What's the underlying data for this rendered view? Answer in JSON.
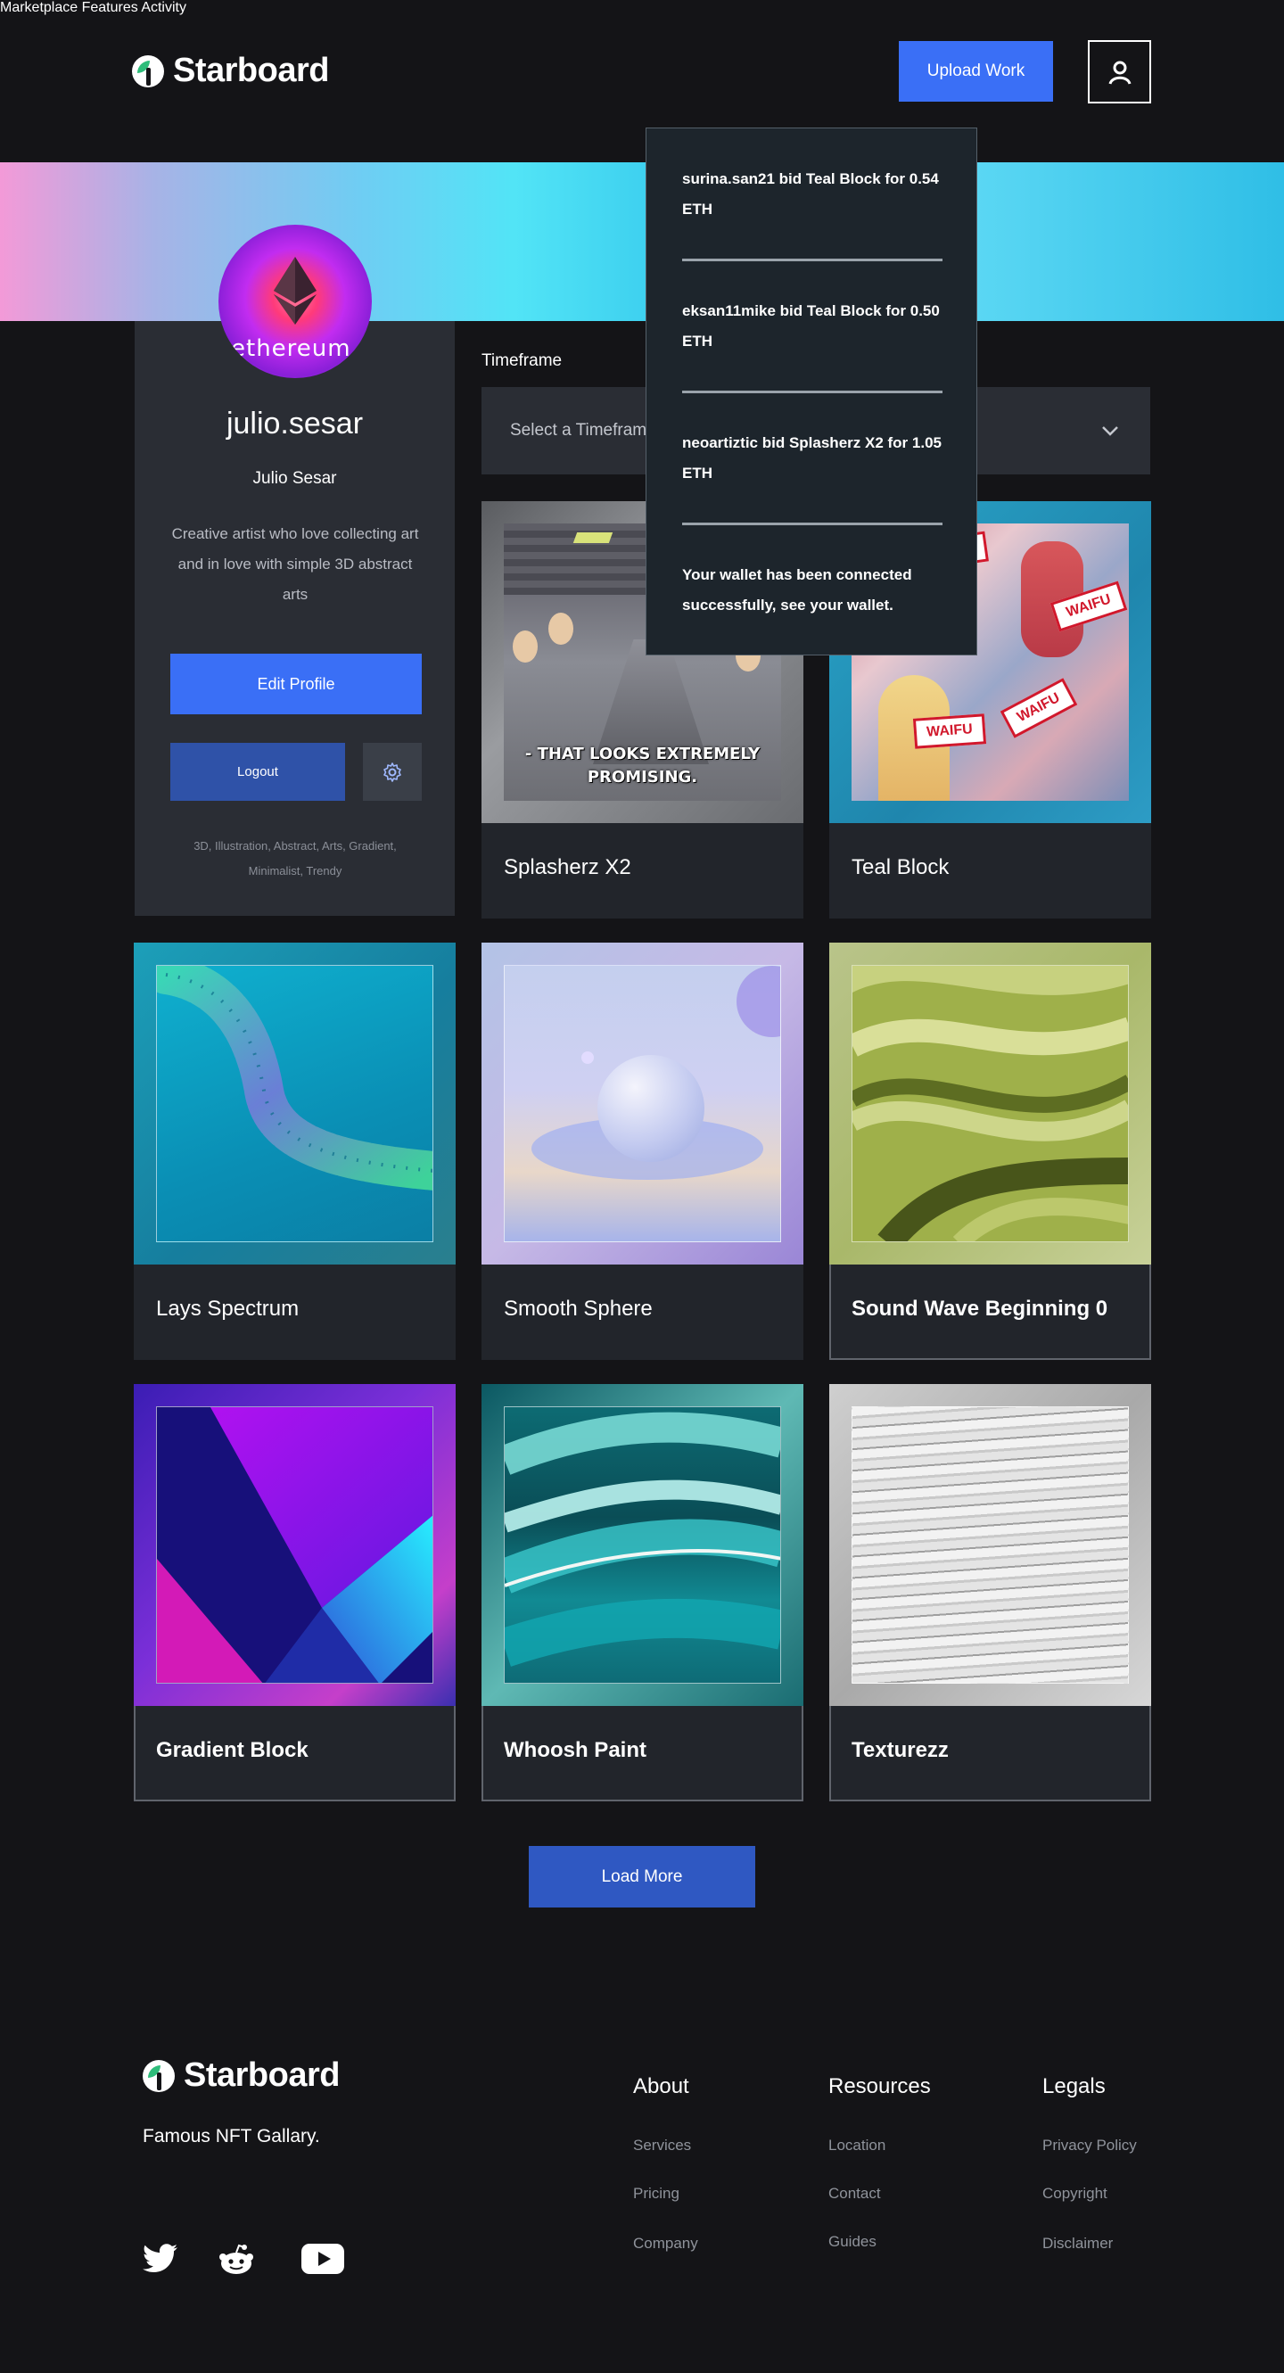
{
  "header": {
    "brand": "Starboard",
    "nav": [
      {
        "label": "Marketplace"
      },
      {
        "label": "Features"
      },
      {
        "label": "Activity"
      }
    ],
    "upload_label": "Upload Work",
    "user_icon": "user-icon"
  },
  "activity": {
    "items": [
      "surina.san21 bid Teal Block for 0.54 ETH",
      "eksan11mike bid Teal Block for 0.50 ETH",
      "neoartiztic bid Splasherz X2 for 1.05 ETH",
      "Your wallet has been connected successfully, see your wallet."
    ]
  },
  "profile": {
    "avatar_text": "ethereum",
    "handle": "julio.sesar",
    "name": "Julio Sesar",
    "bio": "Creative artist who love collecting art and in love with simple 3D abstract arts",
    "edit_label": "Edit Profile",
    "logout_label": "Logout",
    "settings_icon": "gear-icon",
    "tags": "3D, Illustration, Abstract, Arts, Gradient, Minimalist, Trendy"
  },
  "filter": {
    "label": "Timeframe",
    "placeholder": "Select a Timeframe"
  },
  "cards": [
    {
      "title": "Splasherz X2",
      "meme_caption": "- THAT LOOKS EXTREMELY PROMISING."
    },
    {
      "title": "Teal Block",
      "sign_text": "WAIFU"
    },
    {
      "title": "Lays Spectrum"
    },
    {
      "title": "Smooth Sphere"
    },
    {
      "title": "Sound Wave Beginning 0"
    },
    {
      "title": "Gradient Block"
    },
    {
      "title": "Whoosh Paint"
    },
    {
      "title": "Texturezz"
    }
  ],
  "load_more_label": "Load More",
  "footer": {
    "brand": "Starboard",
    "tagline": "Famous NFT Gallary.",
    "columns": [
      {
        "heading": "About",
        "links": [
          "Services",
          "Pricing",
          "Company"
        ]
      },
      {
        "heading": "Resources",
        "links": [
          "Location",
          "Contact",
          "Guides"
        ]
      },
      {
        "heading": "Legals",
        "links": [
          "Privacy Policy",
          "Copyright",
          "Disclaimer"
        ]
      }
    ],
    "social": [
      "twitter-icon",
      "reddit-icon",
      "youtube-icon"
    ]
  },
  "colors": {
    "background": "#141417",
    "card": "#22252b",
    "primary_blue": "#3a6ff6",
    "dark_blue": "#2f52a8",
    "dropdown_bg": "#1d252c"
  }
}
